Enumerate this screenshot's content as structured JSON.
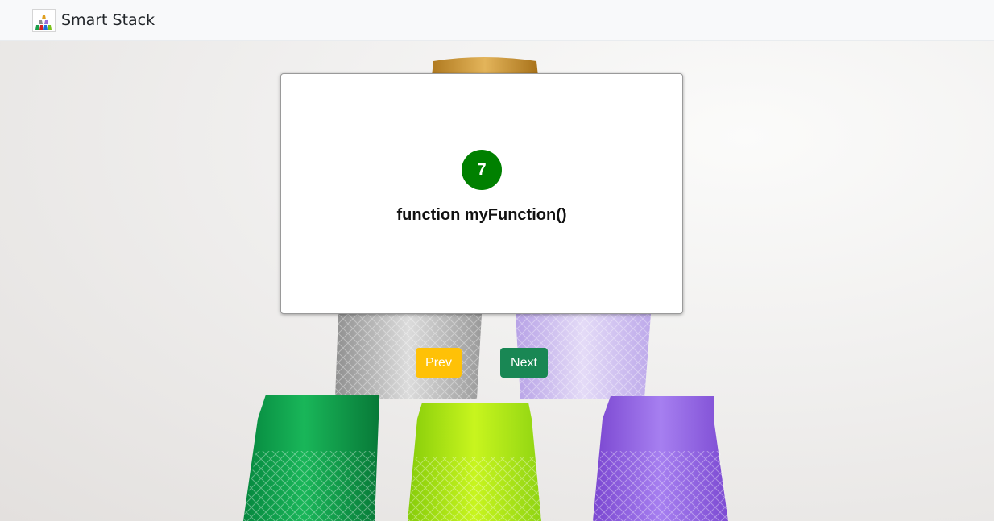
{
  "navbar": {
    "brand_name": "Smart Stack"
  },
  "card": {
    "step_number": "7",
    "text": "function myFunction()"
  },
  "buttons": {
    "prev_label": "Prev",
    "next_label": "Next"
  },
  "colors": {
    "badge": "#008000",
    "prev_button": "#ffc107",
    "next_button": "#198754"
  },
  "icons": {
    "brand_logo": "stacked-cups-logo-icon"
  }
}
